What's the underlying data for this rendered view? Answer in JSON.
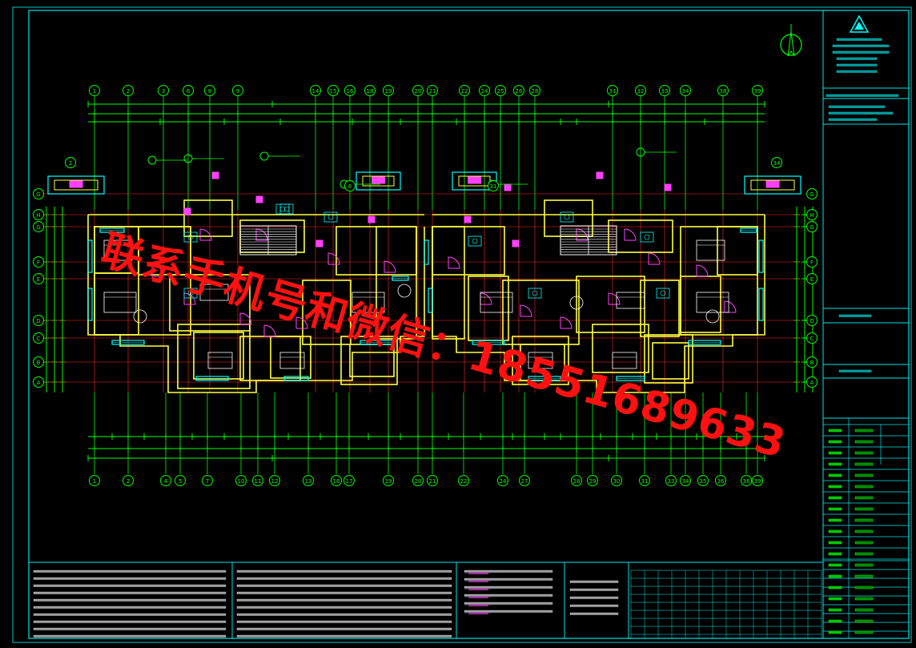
{
  "viewer": {
    "background": "#000000"
  },
  "drawing": {
    "grid_bubbles_top": [
      "1",
      "2",
      "3",
      "6",
      "8",
      "9",
      "14",
      "15",
      "16",
      "18",
      "19",
      "20",
      "21",
      "22",
      "24",
      "25",
      "26",
      "28",
      "31",
      "32",
      "33",
      "34",
      "38",
      "39"
    ],
    "grid_bubbles_bottom": [
      "1",
      "2",
      "4",
      "5",
      "7",
      "10",
      "11",
      "12",
      "13",
      "16",
      "17",
      "19",
      "20",
      "21",
      "22",
      "24",
      "27",
      "28",
      "29",
      "30",
      "31",
      "33",
      "34",
      "35",
      "36",
      "38",
      "39"
    ],
    "row_axes_left": [
      "H",
      "G",
      "F",
      "E",
      "D",
      "C",
      "B",
      "A"
    ],
    "row_axes_right": [
      "H",
      "G",
      "F",
      "E",
      "D",
      "C",
      "B",
      "A"
    ],
    "colors": {
      "frame": "#00e5e5",
      "dimension": "#00ff00",
      "axis": "#ff2a2a",
      "wall": "#ffff40",
      "window": "#00ffff",
      "door": "#ff40ff",
      "furniture": "#ffffff"
    }
  },
  "watermark": {
    "text": "联系手机号和微信：18551689633",
    "color": "#ff1111"
  }
}
